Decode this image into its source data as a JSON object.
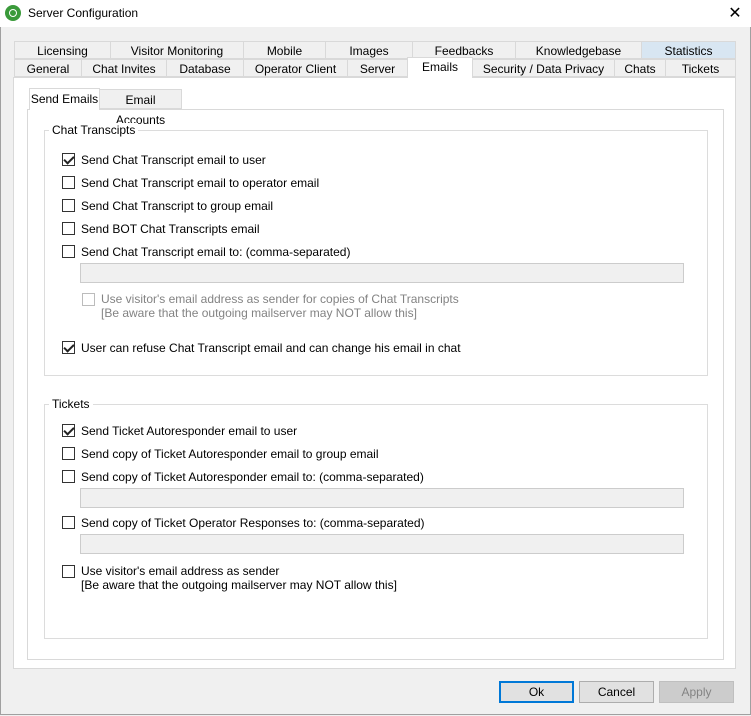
{
  "window": {
    "title": "Server Configuration",
    "close_glyph": "✕"
  },
  "tabs_row1": [
    "Licensing",
    "Visitor Monitoring",
    "Mobile",
    "Images",
    "Feedbacks",
    "Knowledgebase",
    "Statistics"
  ],
  "tabs_row2": [
    "General",
    "Chat Invites",
    "Database",
    "Operator Client",
    "Server",
    "Emails",
    "Security / Data Privacy",
    "Chats",
    "Tickets"
  ],
  "active_tab": "Emails",
  "inner_tabs": [
    "Send Emails",
    "Email Accounts"
  ],
  "chat": {
    "group_label": "Chat Transcipts",
    "opt1": "Send Chat Transcript email to user",
    "opt2": "Send Chat Transcript email to operator email",
    "opt3": "Send Chat Transcript to group email",
    "opt4": "Send BOT Chat Transcripts email",
    "opt5": "Send Chat Transcript email to: (comma-separated)",
    "opt5_value": "",
    "sender_opt": "Use visitor's email address as sender for copies of Chat Transcripts\n[Be aware that the outgoing mailserver may NOT allow this]",
    "refuse_opt": "User can refuse Chat Transcript email and can change his email in chat"
  },
  "tickets": {
    "group_label": "Tickets",
    "opt1": "Send Ticket Autoresponder email to user",
    "opt2": "Send copy of Ticket Autoresponder email to group email",
    "opt3": "Send copy of Ticket Autoresponder email to: (comma-separated)",
    "opt3_value": "",
    "opt4": "Send copy of Ticket Operator Responses to: (comma-separated)",
    "opt4_value": "",
    "sender_opt": "Use visitor's email address as sender\n[Be aware that the outgoing mailserver may NOT allow this]"
  },
  "buttons": {
    "ok": "Ok",
    "cancel": "Cancel",
    "apply": "Apply"
  }
}
